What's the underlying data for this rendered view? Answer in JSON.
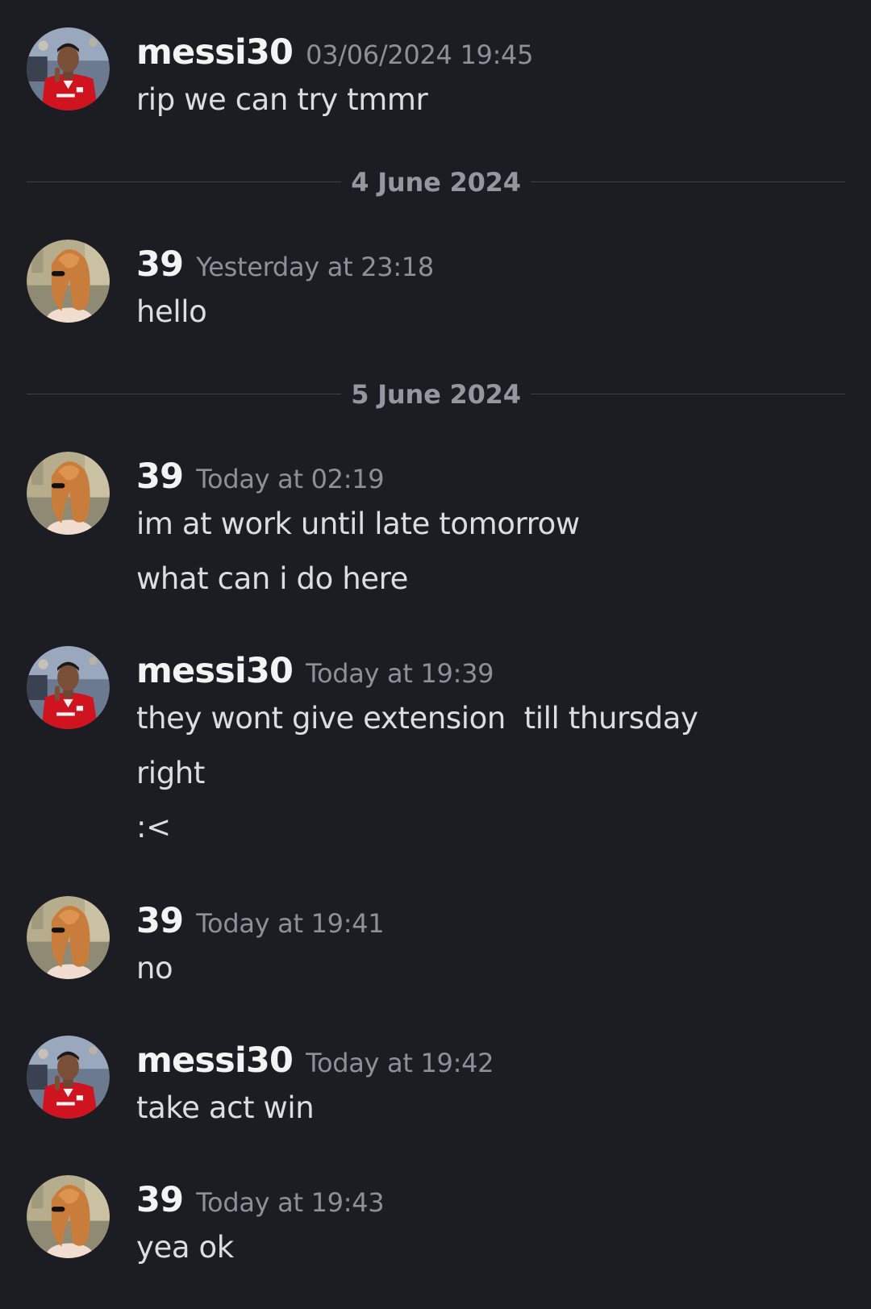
{
  "users": {
    "messi30": {
      "name": "messi30",
      "avatar_icon": "avatar-red-football-kit"
    },
    "u39": {
      "name": "39",
      "avatar_icon": "avatar-orange-hair-sunglasses"
    }
  },
  "messages": [
    {
      "user": "messi30",
      "timestamp": "03/06/2024 19:45",
      "lines": [
        "rip we can try tmmr"
      ]
    },
    {
      "user": "39",
      "timestamp": "Yesterday at 23:18",
      "lines": [
        "hello"
      ]
    },
    {
      "user": "39",
      "timestamp": "Today at 02:19",
      "lines": [
        "im at work until late tomorrow",
        "what can i do here"
      ]
    },
    {
      "user": "messi30",
      "timestamp": "Today at 19:39",
      "lines": [
        "they wont give extension  till thursday",
        "right",
        ":<"
      ]
    },
    {
      "user": "39",
      "timestamp": "Today at 19:41",
      "lines": [
        "no"
      ]
    },
    {
      "user": "messi30",
      "timestamp": "Today at 19:42",
      "lines": [
        "take act win"
      ]
    },
    {
      "user": "39",
      "timestamp": "Today at 19:43",
      "lines": [
        "yea ok"
      ]
    }
  ],
  "dividers": [
    {
      "label": "4 June 2024"
    },
    {
      "label": "5 June 2024"
    }
  ],
  "colors": {
    "background": "#1c1d22",
    "username": "#f2f3f5",
    "timestamp": "#8e9098",
    "message_text": "#dcdde1",
    "divider_text": "#9597a0",
    "divider_line": "#3e4048"
  }
}
